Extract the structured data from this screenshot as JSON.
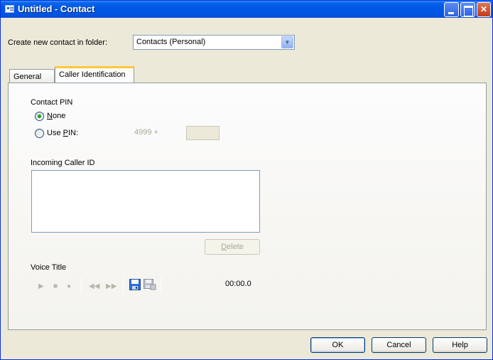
{
  "window": {
    "title": "Untitled - Contact"
  },
  "folder": {
    "label": "Create new contact in folder:",
    "value": "Contacts (Personal)"
  },
  "tabs": [
    {
      "label": "General"
    },
    {
      "label": "Caller Identification"
    }
  ],
  "pin": {
    "heading": "Contact PIN",
    "none_label_u": "N",
    "none_label_rest": "one",
    "use_label_pre": "Use ",
    "use_label_u": "P",
    "use_label_rest": "IN:",
    "prefix": "4999 +"
  },
  "caller_id": {
    "heading": "Incoming Caller ID",
    "delete_u": "D",
    "delete_rest": "elete"
  },
  "voice": {
    "heading": "Voice Title",
    "time": "00:00.0"
  },
  "footer": {
    "ok": "OK",
    "cancel": "Cancel",
    "help": "Help"
  },
  "icons": [
    "contact-window-icon",
    "minimize-icon",
    "maximize-icon",
    "close-icon",
    "play-icon",
    "stop-icon",
    "record-icon",
    "rewind-icon",
    "fast-forward-icon",
    "save-icon",
    "save-all-icon",
    "dropdown-arrow-icon"
  ],
  "colors": {
    "titlebar": "#0055e3",
    "active_tab_accent": "#ffc83c",
    "close_button": "#c43a17"
  }
}
